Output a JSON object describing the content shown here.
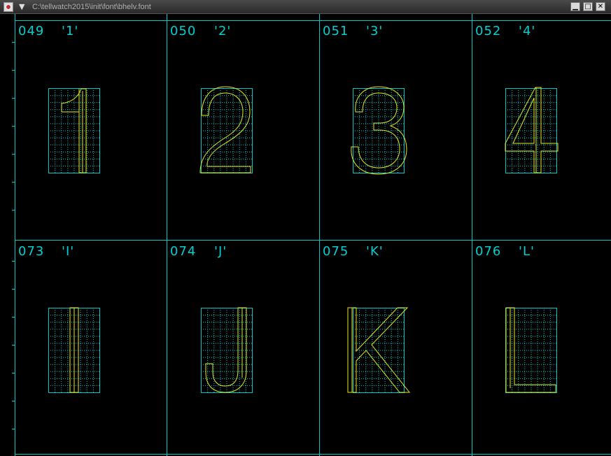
{
  "window": {
    "title": "C:\\tellwatch2015\\init\\font\\bhelv.font",
    "buttons": {
      "minimize": "▁",
      "maximize": "□",
      "close": "✕"
    }
  },
  "colors": {
    "grid": "#00c8c8",
    "glyph": "#e8e820",
    "background": "#000000"
  },
  "glyphs": [
    {
      "code": "049",
      "char": "'1'"
    },
    {
      "code": "050",
      "char": "'2'"
    },
    {
      "code": "051",
      "char": "'3'"
    },
    {
      "code": "052",
      "char": "'4'"
    },
    {
      "code": "073",
      "char": "'I'"
    },
    {
      "code": "074",
      "char": "'J'"
    },
    {
      "code": "075",
      "char": "'K'"
    },
    {
      "code": "076",
      "char": "'L'"
    }
  ]
}
